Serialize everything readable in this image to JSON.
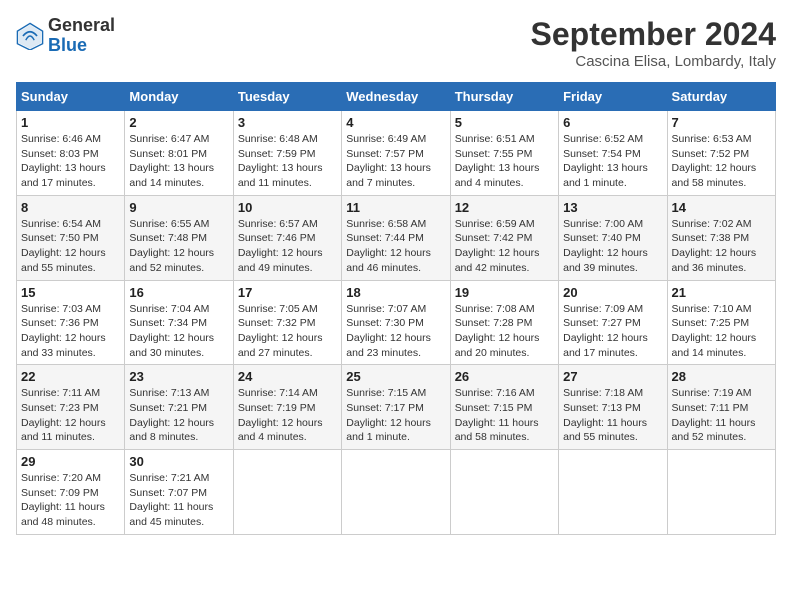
{
  "header": {
    "logo_general": "General",
    "logo_blue": "Blue",
    "month_title": "September 2024",
    "subtitle": "Cascina Elisa, Lombardy, Italy"
  },
  "weekdays": [
    "Sunday",
    "Monday",
    "Tuesday",
    "Wednesday",
    "Thursday",
    "Friday",
    "Saturday"
  ],
  "weeks": [
    [
      {
        "day": "1",
        "sunrise": "Sunrise: 6:46 AM",
        "sunset": "Sunset: 8:03 PM",
        "daylight": "Daylight: 13 hours and 17 minutes."
      },
      {
        "day": "2",
        "sunrise": "Sunrise: 6:47 AM",
        "sunset": "Sunset: 8:01 PM",
        "daylight": "Daylight: 13 hours and 14 minutes."
      },
      {
        "day": "3",
        "sunrise": "Sunrise: 6:48 AM",
        "sunset": "Sunset: 7:59 PM",
        "daylight": "Daylight: 13 hours and 11 minutes."
      },
      {
        "day": "4",
        "sunrise": "Sunrise: 6:49 AM",
        "sunset": "Sunset: 7:57 PM",
        "daylight": "Daylight: 13 hours and 7 minutes."
      },
      {
        "day": "5",
        "sunrise": "Sunrise: 6:51 AM",
        "sunset": "Sunset: 7:55 PM",
        "daylight": "Daylight: 13 hours and 4 minutes."
      },
      {
        "day": "6",
        "sunrise": "Sunrise: 6:52 AM",
        "sunset": "Sunset: 7:54 PM",
        "daylight": "Daylight: 13 hours and 1 minute."
      },
      {
        "day": "7",
        "sunrise": "Sunrise: 6:53 AM",
        "sunset": "Sunset: 7:52 PM",
        "daylight": "Daylight: 12 hours and 58 minutes."
      }
    ],
    [
      {
        "day": "8",
        "sunrise": "Sunrise: 6:54 AM",
        "sunset": "Sunset: 7:50 PM",
        "daylight": "Daylight: 12 hours and 55 minutes."
      },
      {
        "day": "9",
        "sunrise": "Sunrise: 6:55 AM",
        "sunset": "Sunset: 7:48 PM",
        "daylight": "Daylight: 12 hours and 52 minutes."
      },
      {
        "day": "10",
        "sunrise": "Sunrise: 6:57 AM",
        "sunset": "Sunset: 7:46 PM",
        "daylight": "Daylight: 12 hours and 49 minutes."
      },
      {
        "day": "11",
        "sunrise": "Sunrise: 6:58 AM",
        "sunset": "Sunset: 7:44 PM",
        "daylight": "Daylight: 12 hours and 46 minutes."
      },
      {
        "day": "12",
        "sunrise": "Sunrise: 6:59 AM",
        "sunset": "Sunset: 7:42 PM",
        "daylight": "Daylight: 12 hours and 42 minutes."
      },
      {
        "day": "13",
        "sunrise": "Sunrise: 7:00 AM",
        "sunset": "Sunset: 7:40 PM",
        "daylight": "Daylight: 12 hours and 39 minutes."
      },
      {
        "day": "14",
        "sunrise": "Sunrise: 7:02 AM",
        "sunset": "Sunset: 7:38 PM",
        "daylight": "Daylight: 12 hours and 36 minutes."
      }
    ],
    [
      {
        "day": "15",
        "sunrise": "Sunrise: 7:03 AM",
        "sunset": "Sunset: 7:36 PM",
        "daylight": "Daylight: 12 hours and 33 minutes."
      },
      {
        "day": "16",
        "sunrise": "Sunrise: 7:04 AM",
        "sunset": "Sunset: 7:34 PM",
        "daylight": "Daylight: 12 hours and 30 minutes."
      },
      {
        "day": "17",
        "sunrise": "Sunrise: 7:05 AM",
        "sunset": "Sunset: 7:32 PM",
        "daylight": "Daylight: 12 hours and 27 minutes."
      },
      {
        "day": "18",
        "sunrise": "Sunrise: 7:07 AM",
        "sunset": "Sunset: 7:30 PM",
        "daylight": "Daylight: 12 hours and 23 minutes."
      },
      {
        "day": "19",
        "sunrise": "Sunrise: 7:08 AM",
        "sunset": "Sunset: 7:28 PM",
        "daylight": "Daylight: 12 hours and 20 minutes."
      },
      {
        "day": "20",
        "sunrise": "Sunrise: 7:09 AM",
        "sunset": "Sunset: 7:27 PM",
        "daylight": "Daylight: 12 hours and 17 minutes."
      },
      {
        "day": "21",
        "sunrise": "Sunrise: 7:10 AM",
        "sunset": "Sunset: 7:25 PM",
        "daylight": "Daylight: 12 hours and 14 minutes."
      }
    ],
    [
      {
        "day": "22",
        "sunrise": "Sunrise: 7:11 AM",
        "sunset": "Sunset: 7:23 PM",
        "daylight": "Daylight: 12 hours and 11 minutes."
      },
      {
        "day": "23",
        "sunrise": "Sunrise: 7:13 AM",
        "sunset": "Sunset: 7:21 PM",
        "daylight": "Daylight: 12 hours and 8 minutes."
      },
      {
        "day": "24",
        "sunrise": "Sunrise: 7:14 AM",
        "sunset": "Sunset: 7:19 PM",
        "daylight": "Daylight: 12 hours and 4 minutes."
      },
      {
        "day": "25",
        "sunrise": "Sunrise: 7:15 AM",
        "sunset": "Sunset: 7:17 PM",
        "daylight": "Daylight: 12 hours and 1 minute."
      },
      {
        "day": "26",
        "sunrise": "Sunrise: 7:16 AM",
        "sunset": "Sunset: 7:15 PM",
        "daylight": "Daylight: 11 hours and 58 minutes."
      },
      {
        "day": "27",
        "sunrise": "Sunrise: 7:18 AM",
        "sunset": "Sunset: 7:13 PM",
        "daylight": "Daylight: 11 hours and 55 minutes."
      },
      {
        "day": "28",
        "sunrise": "Sunrise: 7:19 AM",
        "sunset": "Sunset: 7:11 PM",
        "daylight": "Daylight: 11 hours and 52 minutes."
      }
    ],
    [
      {
        "day": "29",
        "sunrise": "Sunrise: 7:20 AM",
        "sunset": "Sunset: 7:09 PM",
        "daylight": "Daylight: 11 hours and 48 minutes."
      },
      {
        "day": "30",
        "sunrise": "Sunrise: 7:21 AM",
        "sunset": "Sunset: 7:07 PM",
        "daylight": "Daylight: 11 hours and 45 minutes."
      },
      null,
      null,
      null,
      null,
      null
    ]
  ]
}
